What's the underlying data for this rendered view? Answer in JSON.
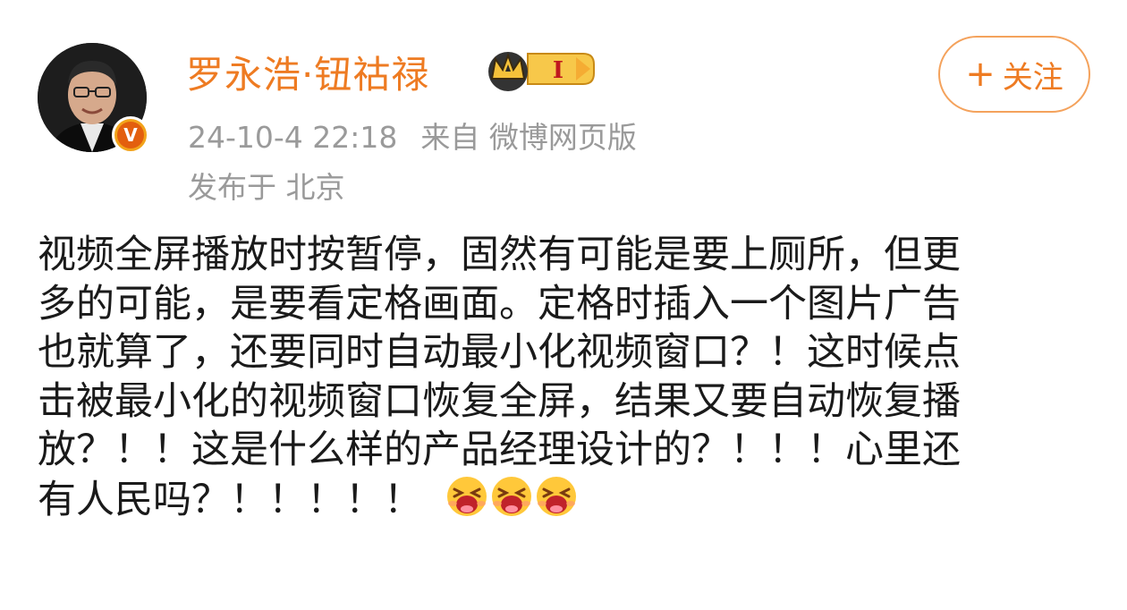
{
  "author": {
    "name": "罗永浩·钮祜禄",
    "member_level": "I",
    "verified_mark": "V"
  },
  "meta": {
    "timestamp": "24-10-4 22:18",
    "source": "来自 微博网页版",
    "location": "发布于 北京"
  },
  "follow_button": {
    "plus": "+",
    "label": "关注"
  },
  "post": {
    "lines": [
      "视频全屏播放时按暂停，固然有可能是要上厕所，但更",
      "多的可能，是要看定格画面。定格时插入一个图片广告",
      "也就算了，还要同时自动最小化视频窗口？！这时候点",
      "击被最小化的视频窗口恢复全屏，结果又要自动恢复播",
      "放？！！这是什么样的产品经理设计的？！！！心里还",
      "有人民吗？！！！！！"
    ],
    "emojis": [
      "crying-face-emoji",
      "crying-face-emoji",
      "crying-face-emoji"
    ]
  },
  "colors": {
    "username": "#ee7b22",
    "meta": "#9a9a9a",
    "body": "#1a1a1a",
    "follow_border": "#f4a25c",
    "badge_gold": "#f2a31a"
  }
}
